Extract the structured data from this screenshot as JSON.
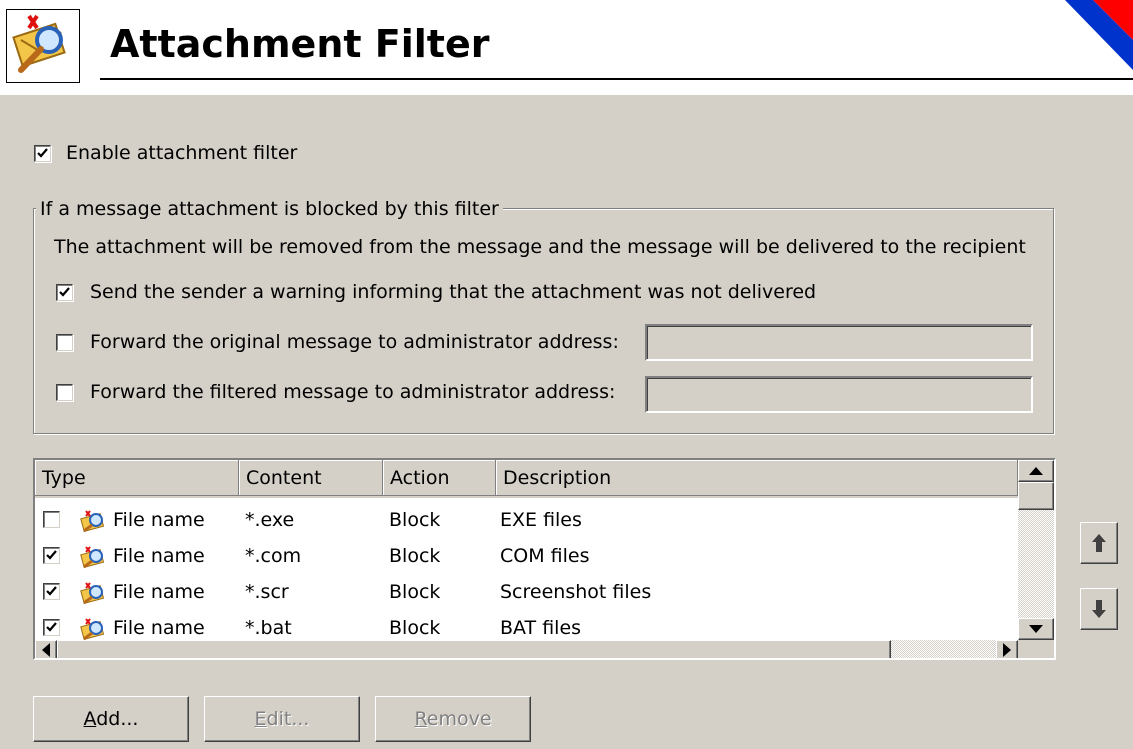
{
  "header": {
    "title": "Attachment Filter",
    "icon": "attachment-filter-icon"
  },
  "enable_filter": {
    "label": "Enable attachment filter",
    "checked": true
  },
  "blocked_group": {
    "legend": "If a message attachment is blocked by this filter",
    "info": "The attachment will be removed from the message and the message will be delivered to the recipient",
    "send_warning": {
      "label": "Send the sender a warning informing that the attachment was not delivered",
      "checked": true
    },
    "forward_original": {
      "label": "Forward the original message to administrator address:",
      "checked": false,
      "value": ""
    },
    "forward_filtered": {
      "label": "Forward the filtered message to administrator address:",
      "checked": false,
      "value": ""
    }
  },
  "filter_list": {
    "columns": [
      "Type",
      "Content",
      "Action",
      "Description"
    ],
    "rows": [
      {
        "checked": false,
        "type": "File name",
        "content": "*.exe",
        "action": "Block",
        "description": "EXE files"
      },
      {
        "checked": true,
        "type": "File name",
        "content": "*.com",
        "action": "Block",
        "description": "COM files"
      },
      {
        "checked": true,
        "type": "File name",
        "content": "*.scr",
        "action": "Block",
        "description": "Screenshot files"
      },
      {
        "checked": true,
        "type": "File name",
        "content": "*.bat",
        "action": "Block",
        "description": "BAT files"
      }
    ]
  },
  "buttons": {
    "add": {
      "mnemonic": "A",
      "rest": "dd..."
    },
    "edit": {
      "mnemonic": "E",
      "rest": "dit...",
      "disabled": true
    },
    "remove": {
      "mnemonic": "R",
      "rest": "emove",
      "disabled": true
    }
  },
  "move_buttons": {
    "up_icon": "arrow-up-icon",
    "down_icon": "arrow-down-icon"
  },
  "colors": {
    "dialog_bg": "#d4d0c8",
    "header_bg": "#ffffff",
    "flag_red": "#ff0000",
    "flag_blue": "#0033cc"
  }
}
